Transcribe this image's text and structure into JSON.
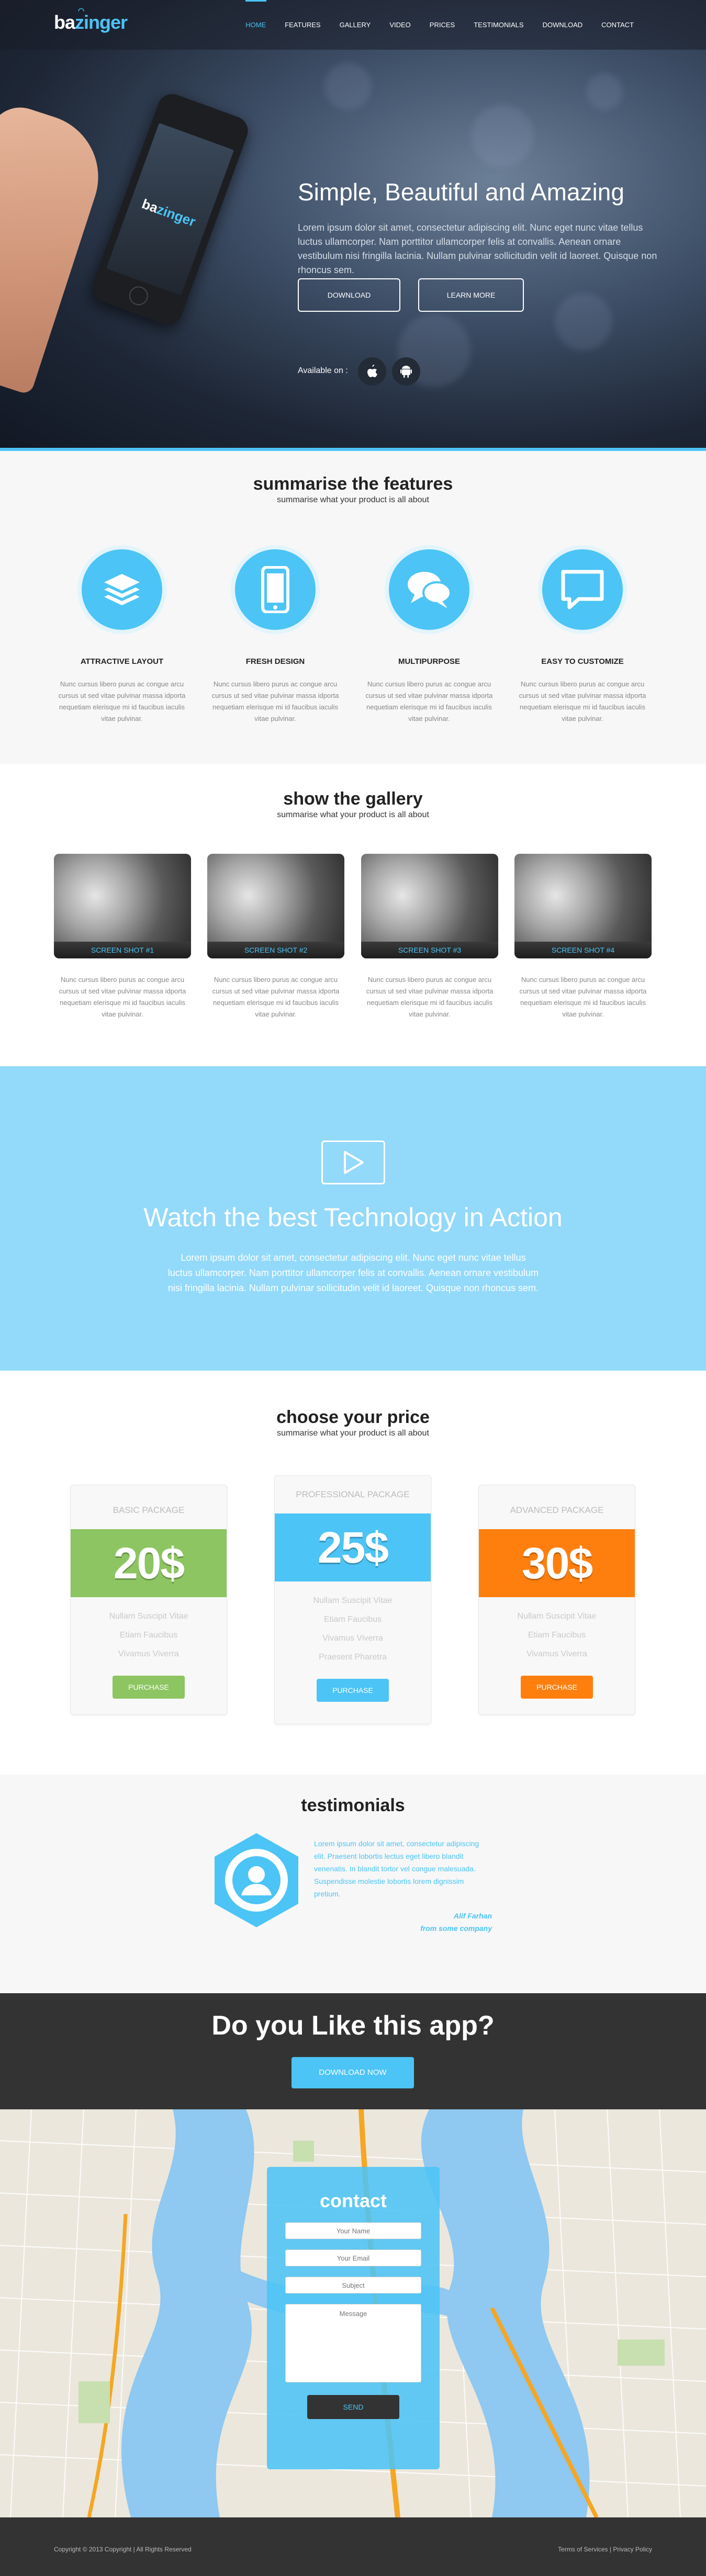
{
  "brand": {
    "logo_a": "ba",
    "logo_b": "zinger"
  },
  "nav": {
    "items": [
      "HOME",
      "FEATURES",
      "GALLERY",
      "VIDEO",
      "PRICES",
      "TESTIMONIALS",
      "DOWNLOAD",
      "CONTACT"
    ],
    "active": 0
  },
  "hero": {
    "phone_logo_a": "ba",
    "phone_logo_b": "zinger",
    "title": "Simple, Beautiful and Amazing",
    "text": "Lorem ipsum dolor sit amet, consectetur adipiscing elit. Nunc eget nunc vitae tellus luctus ullamcorper. Nam porttitor ullamcorper felis at convallis. Aenean ornare vestibulum nisi fringilla lacinia. Nullam pulvinar sollicitudin velit id laoreet. Quisque non rhoncus sem.",
    "download_btn": "DOWNLOAD",
    "learn_btn": "LEARN MORE",
    "available_label": "Available on :"
  },
  "features": {
    "title": "summarise the features",
    "subtitle": "summarise what your product is all about",
    "items": [
      {
        "icon": "layers-icon",
        "title": "ATTRACTIVE LAYOUT",
        "text": "Nunc cursus libero purus ac congue arcu cursus ut sed vitae pulvinar massa idporta nequetiam elerisque mi id faucibus iaculis vitae pulvinar."
      },
      {
        "icon": "mobile-icon",
        "title": "FRESH DESIGN",
        "text": "Nunc cursus libero purus ac congue arcu cursus ut sed vitae pulvinar massa idporta nequetiam elerisque mi id faucibus iaculis vitae pulvinar."
      },
      {
        "icon": "chat-icon",
        "title": "MULTIPURPOSE",
        "text": "Nunc cursus libero purus ac congue arcu cursus ut sed vitae pulvinar massa idporta nequetiam elerisque mi id faucibus iaculis vitae pulvinar."
      },
      {
        "icon": "comment-icon",
        "title": "EASY TO CUSTOMIZE",
        "text": "Nunc cursus libero purus ac congue arcu cursus ut sed vitae pulvinar massa idporta nequetiam elerisque mi id faucibus iaculis vitae pulvinar."
      }
    ]
  },
  "gallery": {
    "title": "show the gallery",
    "subtitle": "summarise what your product is all about",
    "shots": [
      {
        "caption": "SCREEN SHOT #1",
        "text": "Nunc cursus libero purus ac congue arcu cursus ut sed vitae pulvinar massa idporta nequetiam elerisque mi id faucibus iaculis vitae pulvinar."
      },
      {
        "caption": "SCREEN SHOT #2",
        "text": "Nunc cursus libero purus ac congue arcu cursus ut sed vitae pulvinar massa idporta nequetiam elerisque mi id faucibus iaculis vitae pulvinar."
      },
      {
        "caption": "SCREEN SHOT #3",
        "text": "Nunc cursus libero purus ac congue arcu cursus ut sed vitae pulvinar massa idporta nequetiam elerisque mi id faucibus iaculis vitae pulvinar."
      },
      {
        "caption": "SCREEN SHOT #4",
        "text": "Nunc cursus libero purus ac congue arcu cursus ut sed vitae pulvinar massa idporta nequetiam elerisque mi id faucibus iaculis vitae pulvinar."
      }
    ]
  },
  "video": {
    "title": "Watch the best Technology in Action",
    "text": "Lorem ipsum dolor sit amet, consectetur adipiscing elit. Nunc eget nunc vitae tellus luctus ullamcorper. Nam porttitor ullamcorper felis at convallis. Aenean ornare vestibulum nisi fringilla lacinia. Nullam pulvinar sollicitudin velit id laoreet. Quisque non rhoncus sem."
  },
  "pricing": {
    "title": "choose your price",
    "subtitle": "summarise what your product is all about",
    "packages": [
      {
        "name": "BASIC PACKAGE",
        "price": "20$",
        "color": "#8cc561",
        "features": [
          "Nullam Suscipit Vitae",
          "Etiam Faucibus",
          "Vivamus Viverra"
        ],
        "button": "PURCHASE"
      },
      {
        "name": "PROFESSIONAL PACKAGE",
        "price": "25$",
        "color": "#4cc4f5",
        "features": [
          "Nullam Suscipit Vitae",
          "Etiam Faucibus",
          "Vivamus Viverra",
          "Praesent Pharetra"
        ],
        "button": "PURCHASE"
      },
      {
        "name": "ADVANCED PACKAGE",
        "price": "30$",
        "color": "#ff7f0e",
        "features": [
          "Nullam Suscipit Vitae",
          "Etiam Faucibus",
          "Vivamus Viverra"
        ],
        "button": "PURCHASE"
      }
    ]
  },
  "testimonials": {
    "title": "testimonials",
    "quote": "Lorem ipsum dolor sit amet, consectetur adipiscing elit. Praesent lobortis lectus eget libero blandit venenatis. In blandit tortor vel congue malesuada. Suspendisse molestie lobortis lorem dignissim pretium.",
    "author": "Alif Farhan",
    "company": "from some company"
  },
  "cta": {
    "title": "Do you Like this app?",
    "button": "DOWNLOAD NOW"
  },
  "contact": {
    "title": "contact",
    "name_placeholder": "Your Name",
    "email_placeholder": "Your Email",
    "subject_placeholder": "Subject",
    "message_placeholder": "Message",
    "send": "SEND"
  },
  "footer": {
    "left": "Copyright © 2013 Copyright | All Rights Reserved",
    "right": "Terms of Services | Privacy Policy"
  }
}
